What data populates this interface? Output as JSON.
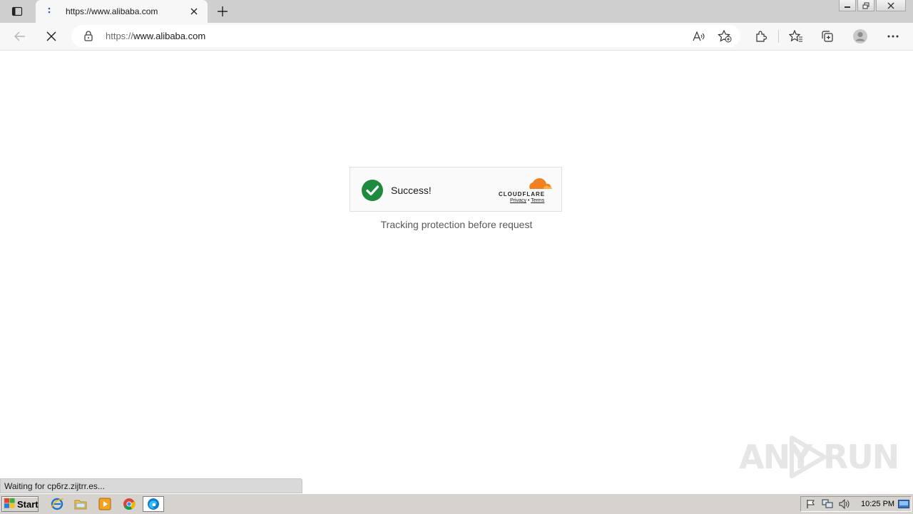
{
  "browser": {
    "tab": {
      "title": "https://www.alibaba.com"
    },
    "address": {
      "scheme": "https://",
      "host": "www.alibaba.com"
    }
  },
  "page": {
    "widget": {
      "status_text": "Success!",
      "brand": "CLOUDFLARE",
      "privacy_link": "Privacy",
      "separator": "•",
      "terms_link": "Terms"
    },
    "caption": "Tracking protection before request"
  },
  "status_bar": {
    "text": "Waiting for cp6rz.zijtrr.es..."
  },
  "watermark": {
    "left": "ANY",
    "right": "RUN"
  },
  "taskbar": {
    "start_label": "Start",
    "clock": "10:25 PM"
  },
  "colors": {
    "success_green": "#1d8a3e",
    "cloudflare_orange": "#f38020",
    "cloudflare_yellow": "#faae40"
  }
}
